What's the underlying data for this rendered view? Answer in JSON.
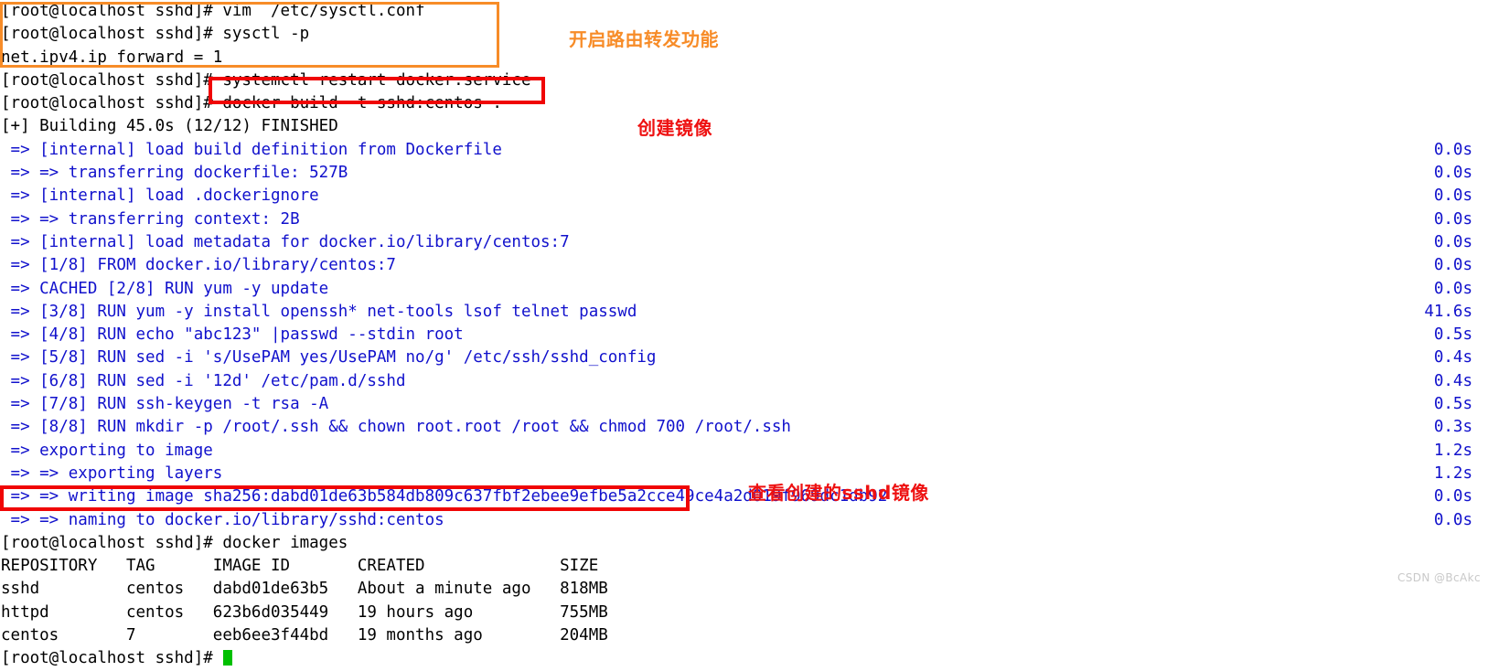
{
  "terminal": {
    "prompt": "[root@localhost sshd]#",
    "lines": [
      {
        "text": "[root@localhost sshd]# vim  /etc/sysctl.conf",
        "color": "black",
        "timing": ""
      },
      {
        "text": "[root@localhost sshd]# sysctl -p",
        "color": "black",
        "timing": ""
      },
      {
        "text": "net.ipv4.ip_forward = 1",
        "color": "black",
        "timing": ""
      },
      {
        "text": "[root@localhost sshd]# systemctl restart docker.service",
        "color": "black",
        "timing": ""
      },
      {
        "text": "[root@localhost sshd]# docker build -t sshd:centos .",
        "color": "black",
        "timing": ""
      },
      {
        "text": "[+] Building 45.0s (12/12) FINISHED",
        "color": "black",
        "timing": ""
      },
      {
        "text": " => [internal] load build definition from Dockerfile",
        "color": "blue",
        "timing": "0.0s"
      },
      {
        "text": " => => transferring dockerfile: 527B",
        "color": "blue",
        "timing": "0.0s"
      },
      {
        "text": " => [internal] load .dockerignore",
        "color": "blue",
        "timing": "0.0s"
      },
      {
        "text": " => => transferring context: 2B",
        "color": "blue",
        "timing": "0.0s"
      },
      {
        "text": " => [internal] load metadata for docker.io/library/centos:7",
        "color": "blue",
        "timing": "0.0s"
      },
      {
        "text": " => [1/8] FROM docker.io/library/centos:7",
        "color": "blue",
        "timing": "0.0s"
      },
      {
        "text": " => CACHED [2/8] RUN yum -y update",
        "color": "blue",
        "timing": "0.0s"
      },
      {
        "text": " => [3/8] RUN yum -y install openssh* net-tools lsof telnet passwd",
        "color": "blue",
        "timing": "41.6s"
      },
      {
        "text": " => [4/8] RUN echo \"abc123\" |passwd --stdin root",
        "color": "blue",
        "timing": "0.5s"
      },
      {
        "text": " => [5/8] RUN sed -i 's/UsePAM yes/UsePAM no/g' /etc/ssh/sshd_config",
        "color": "blue",
        "timing": "0.4s"
      },
      {
        "text": " => [6/8] RUN sed -i '12d' /etc/pam.d/sshd",
        "color": "blue",
        "timing": "0.4s"
      },
      {
        "text": " => [7/8] RUN ssh-keygen -t rsa -A",
        "color": "blue",
        "timing": "0.5s"
      },
      {
        "text": " => [8/8] RUN mkdir -p /root/.ssh && chown root.root /root && chmod 700 /root/.ssh",
        "color": "blue",
        "timing": "0.3s"
      },
      {
        "text": " => exporting to image",
        "color": "blue",
        "timing": "1.2s"
      },
      {
        "text": " => => exporting layers",
        "color": "blue",
        "timing": "1.2s"
      },
      {
        "text": " => => writing image sha256:dabd01de63b584db809c637fbf2ebee9efbe5a2cce49ce4a2d019f969dc1db92",
        "color": "blue",
        "timing": "0.0s"
      },
      {
        "text": " => => naming to docker.io/library/sshd:centos",
        "color": "blue",
        "timing": "0.0s"
      },
      {
        "text": "[root@localhost sshd]# docker images",
        "color": "black",
        "timing": ""
      },
      {
        "text": "REPOSITORY   TAG      IMAGE ID       CREATED              SIZE",
        "color": "black",
        "timing": ""
      },
      {
        "text": "sshd         centos   dabd01de63b5   About a minute ago   818MB",
        "color": "black",
        "timing": ""
      },
      {
        "text": "httpd        centos   623b6d035449   19 hours ago         755MB",
        "color": "black",
        "timing": ""
      },
      {
        "text": "centos       7        eeb6ee3f44bd   19 months ago        204MB",
        "color": "black",
        "timing": ""
      },
      {
        "text": "[root@localhost sshd]# ",
        "color": "black",
        "timing": ""
      }
    ]
  },
  "annotations": [
    {
      "text": "开启路由转发功能",
      "color": "#f78c28"
    },
    {
      "text": "创建镜像",
      "color": "#ee1111"
    },
    {
      "text": "查看创建的sshd镜像",
      "color": "#ee1111"
    }
  ],
  "watermark": "CSDN @BcAkc"
}
